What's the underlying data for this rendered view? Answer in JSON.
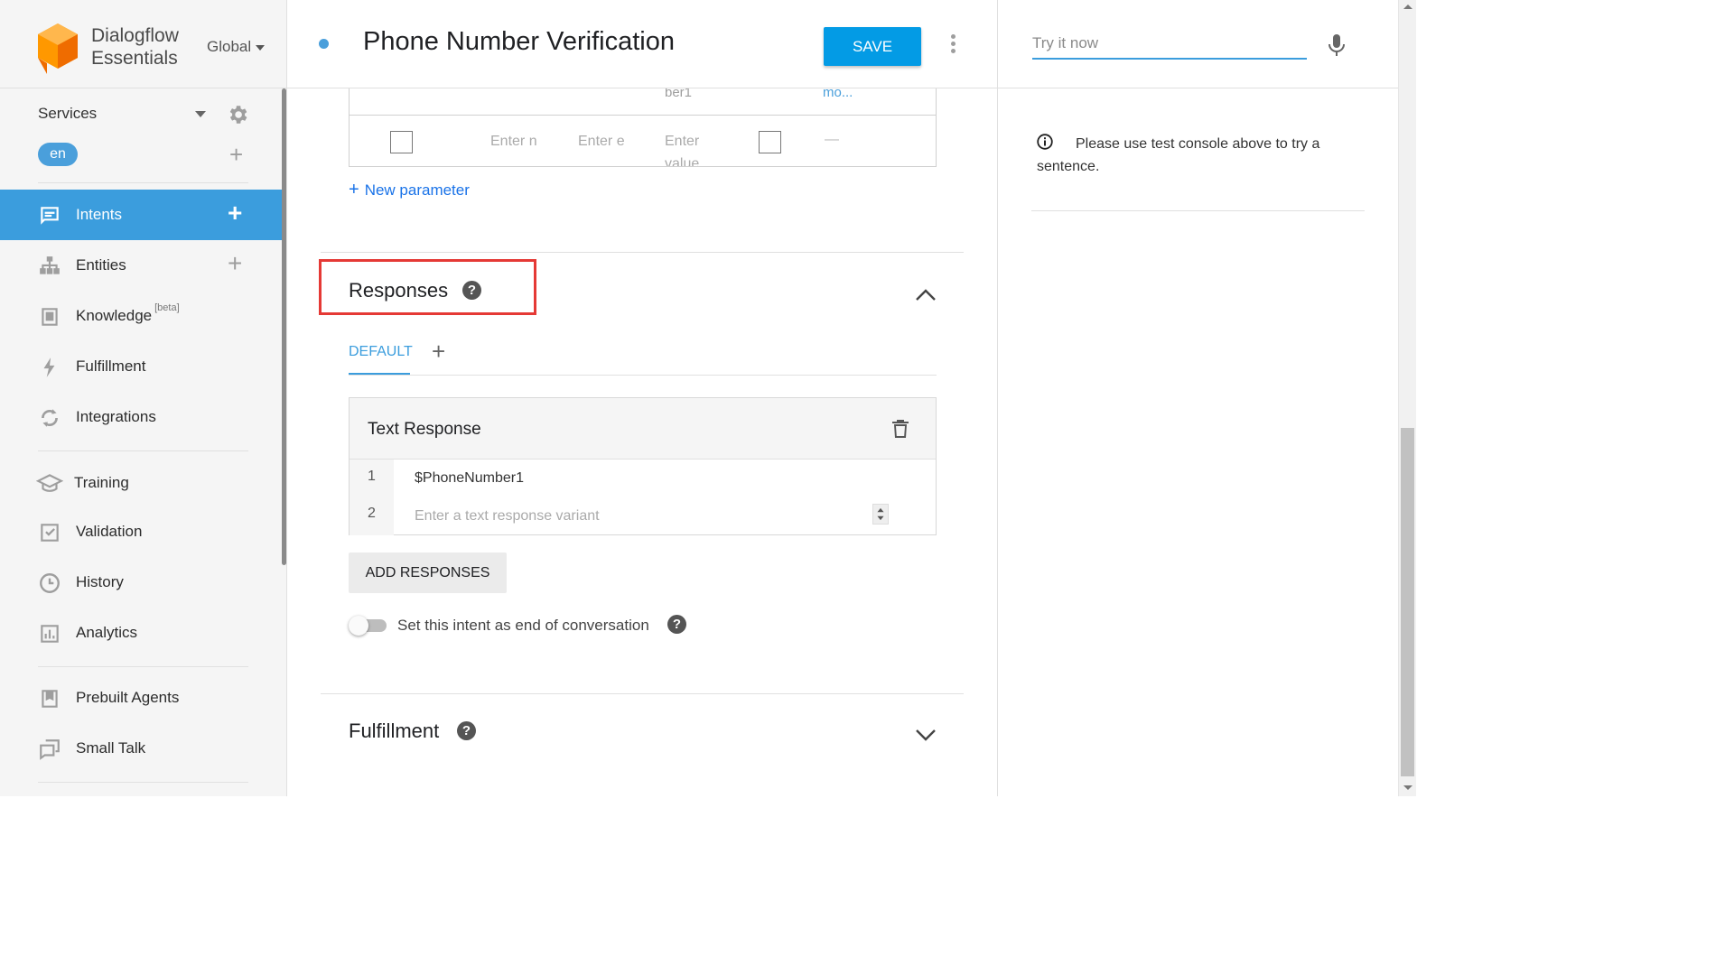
{
  "brand": {
    "name_line1": "Dialogflow",
    "name_line2": "Essentials",
    "region": "Global"
  },
  "agent": {
    "name": "Services",
    "language": "en"
  },
  "nav": {
    "intents": "Intents",
    "entities": "Entities",
    "knowledge": "Knowledge",
    "knowledge_badge": "[beta]",
    "fulfillment": "Fulfillment",
    "integrations": "Integrations",
    "training": "Training",
    "validation": "Validation",
    "history": "History",
    "analytics": "Analytics",
    "prebuilt_agents": "Prebuilt Agents",
    "small_talk": "Small Talk",
    "active_item": "Intents"
  },
  "header": {
    "title": "Phone Number Verification",
    "save_label": "SAVE"
  },
  "params": {
    "cut_text_1": "ber1",
    "cut_text_2": "mo...",
    "placeholder_name": "Enter name",
    "placeholder_entity": "Enter entity",
    "placeholder_value_line1": "Enter",
    "placeholder_value_line2": "value",
    "prompts_dash": "—",
    "new_parameter": "New parameter"
  },
  "responses": {
    "title": "Responses",
    "help": "?",
    "tab_default": "DEFAULT",
    "tab_add": "+",
    "text_response_title": "Text Response",
    "rows": [
      {
        "num": "1",
        "value": "$PhoneNumber1"
      },
      {
        "num": "2",
        "placeholder": "Enter a text response variant"
      }
    ],
    "add_button": "ADD RESPONSES",
    "end_conversation_label": "Set this intent as end of conversation",
    "end_conversation_on": false
  },
  "fulfillment": {
    "title": "Fulfillment",
    "help": "?"
  },
  "test_console": {
    "placeholder": "Try it now",
    "info": "Please use test console above to try a sentence."
  },
  "colors": {
    "accent": "#3b9ddd",
    "save": "#039be5",
    "highlight": "#e53935",
    "logo": "#ff9800"
  }
}
